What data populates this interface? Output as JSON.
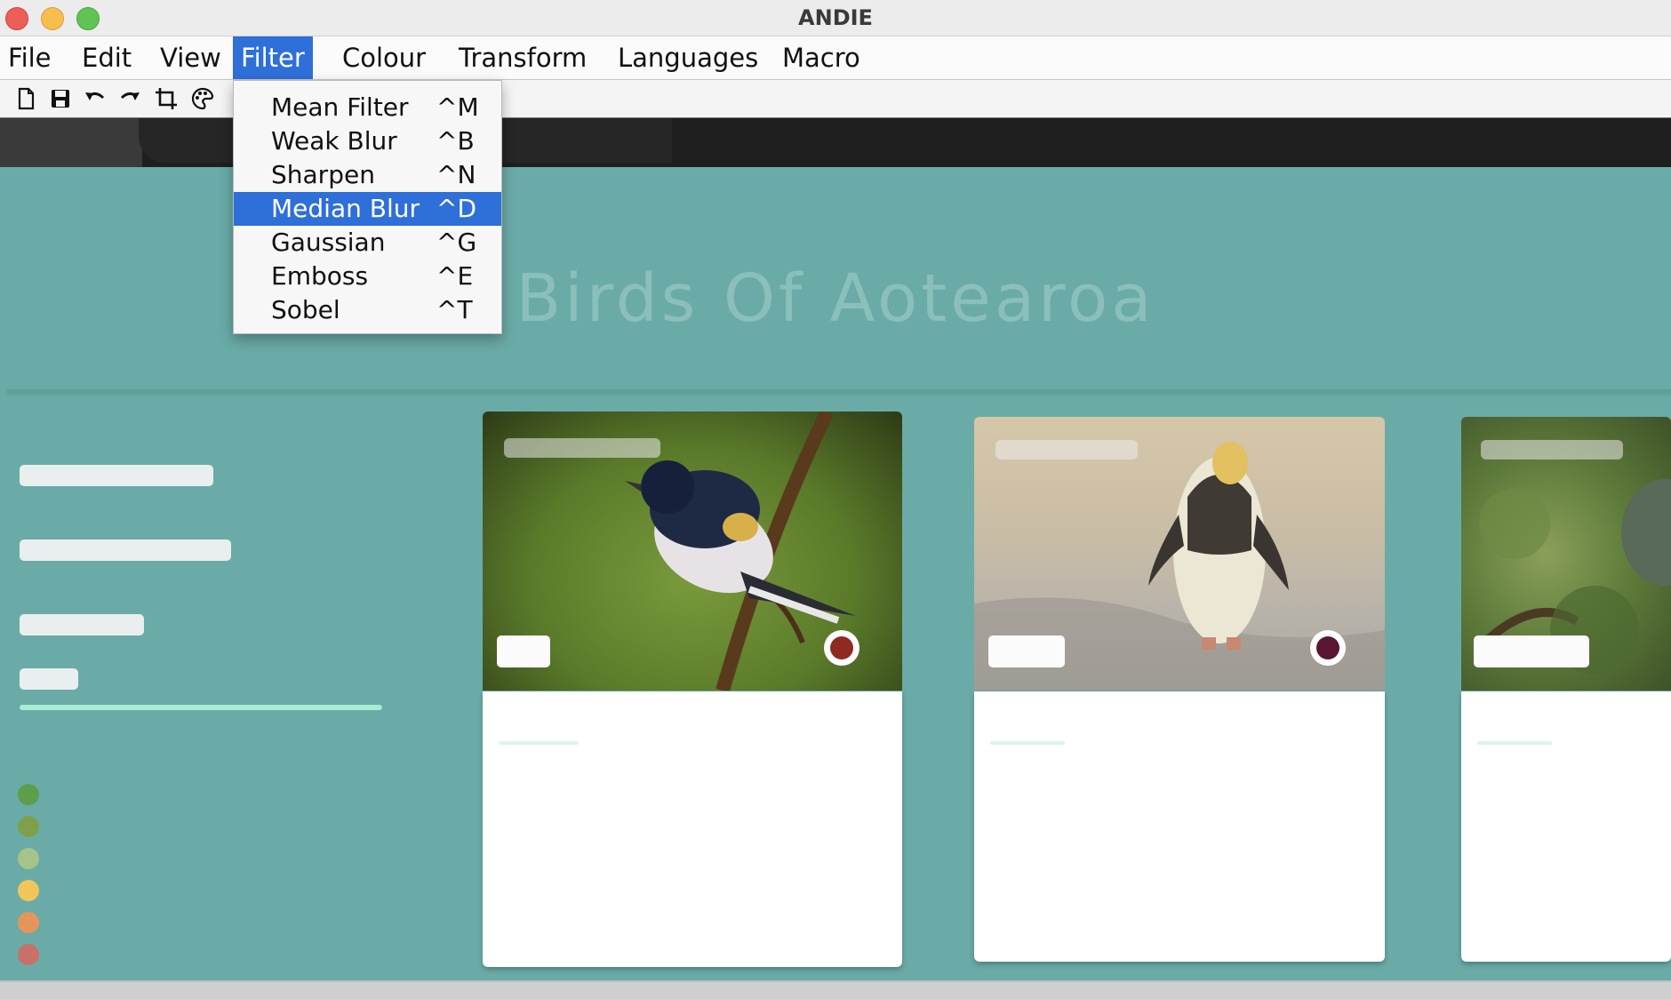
{
  "window": {
    "title": "ANDIE"
  },
  "menubar": [
    {
      "label": "File",
      "active": false
    },
    {
      "label": "Edit",
      "active": false
    },
    {
      "label": "View",
      "active": false
    },
    {
      "label": "Filter",
      "active": true
    },
    {
      "label": "Colour",
      "active": false
    },
    {
      "label": "Transform",
      "active": false
    },
    {
      "label": "Languages",
      "active": false
    },
    {
      "label": "Macro",
      "active": false
    }
  ],
  "toolbar": [
    {
      "icon": "new-file-icon"
    },
    {
      "icon": "save-icon"
    },
    {
      "icon": "undo-icon"
    },
    {
      "icon": "redo-icon"
    },
    {
      "icon": "crop-icon"
    },
    {
      "icon": "palette-icon"
    }
  ],
  "filter_menu": {
    "items": [
      {
        "label": "Mean Filter",
        "shortcut": "^M",
        "selected": false
      },
      {
        "label": "Weak Blur",
        "shortcut": "^B",
        "selected": false
      },
      {
        "label": "Sharpen",
        "shortcut": "^N",
        "selected": false
      },
      {
        "label": "Median Blur",
        "shortcut": "^D",
        "selected": true
      },
      {
        "label": "Gaussian",
        "shortcut": "^G",
        "selected": false
      },
      {
        "label": "Emboss",
        "shortcut": "^E",
        "selected": false
      },
      {
        "label": "Sobel",
        "shortcut": "^T",
        "selected": false
      }
    ]
  },
  "image": {
    "heading": "Birds Of Aotearoa",
    "colors": {
      "background": "#6aaba7",
      "record_red": "#8f2a22",
      "record_maroon": "#5a1530"
    },
    "swatches": [
      "#5c9e4a",
      "#7ea04a",
      "#a4c48a",
      "#f0c65a",
      "#e6955a",
      "#c9706a"
    ]
  }
}
